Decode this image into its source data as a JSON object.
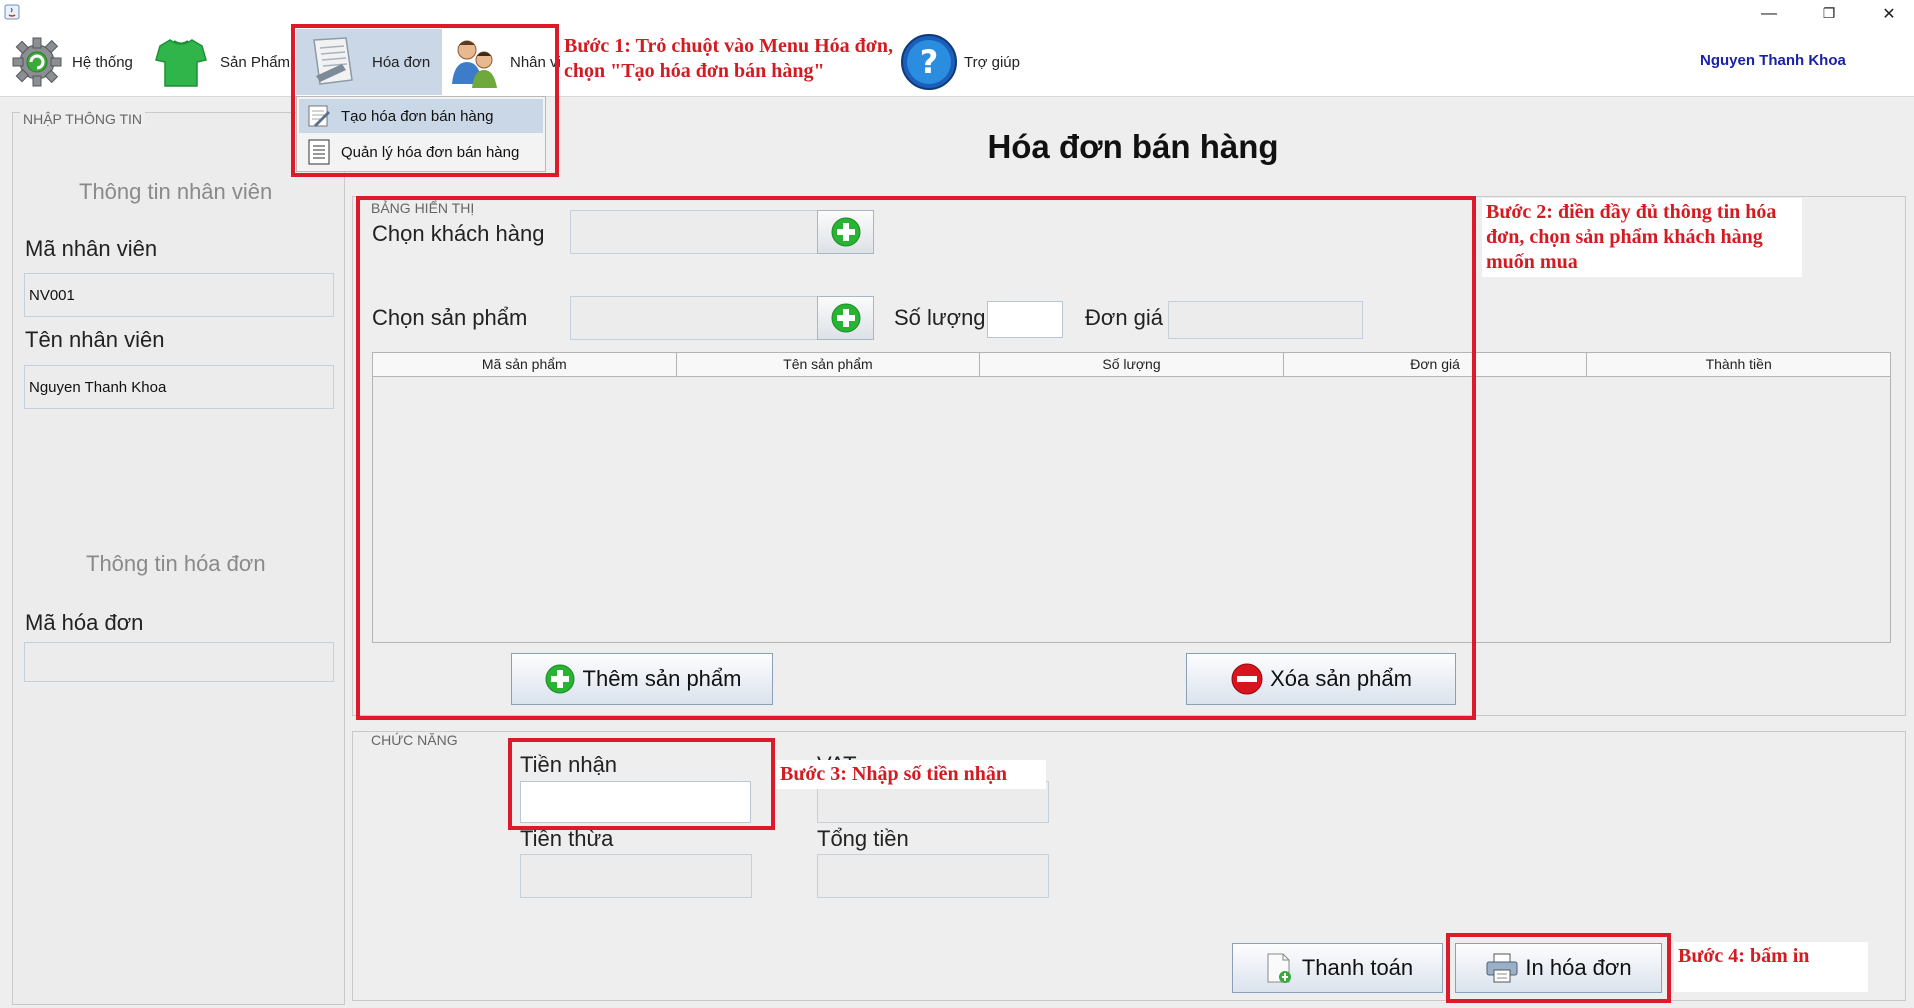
{
  "window": {
    "minimize": "—",
    "restore": "❐",
    "close": "✕"
  },
  "menu": {
    "items": [
      {
        "label": "Hệ thống",
        "icon": "gear-icon"
      },
      {
        "label": "Sản Phẩm",
        "icon": "shirt-icon"
      },
      {
        "label": "Hóa đơn",
        "icon": "receipt-icon"
      },
      {
        "label": "Nhân viên",
        "icon": "people-icon"
      },
      {
        "label": "Trợ giúp",
        "icon": "help-icon"
      }
    ],
    "user": "Nguyen Thanh Khoa",
    "dropdown": [
      "Tạo hóa đơn bán hàng",
      "Quản lý hóa đơn bán hàng"
    ]
  },
  "left": {
    "group_title": "NHẬP THÔNG TIN",
    "employee_section": "Thông tin nhân viên",
    "employee_id_label": "Mã nhân viên",
    "employee_id": "NV001",
    "employee_name_label": "Tên nhân viên",
    "employee_name": "Nguyen Thanh Khoa",
    "invoice_section": "Thông tin hóa đơn",
    "invoice_id_label": "Mã hóa đơn",
    "invoice_id": ""
  },
  "main": {
    "title": "Hóa đơn bán hàng",
    "display_group": "BẢNG HIỂN THỊ",
    "customer_label": "Chọn khách hàng",
    "product_label": "Chọn sản phẩm",
    "quantity_label": "Số lượng",
    "unit_price_label": "Đơn giá",
    "table_headers": [
      "Mã sản phẩm",
      "Tên sản phẩm",
      "Số lượng",
      "Đơn giá",
      "Thành tiền"
    ],
    "add_button": "Thêm sản phẩm",
    "delete_button": "Xóa sản phẩm",
    "function_group": "CHỨC NĂNG",
    "received_label": "Tiền nhận",
    "vat_label": "VAT",
    "change_label": "Tiền thừa",
    "total_label": "Tổng tiền",
    "pay_button": "Thanh toán",
    "print_button": "In hóa đơn"
  },
  "annotations": {
    "step1": "Bước 1: Trỏ chuột vào Menu Hóa đơn, chọn \"Tạo hóa đơn bán hàng\"",
    "step2": "Bước 2: điền đầy đủ thông tin hóa đơn, chọn sản phẩm khách hàng muốn mua",
    "step3": "Bước 3: Nhập số tiền nhận",
    "step4": "Bước 4: bấm in"
  },
  "colors": {
    "annotation_red": "#dd1a2a",
    "user_blue": "#1a22a8",
    "plus_green": "#28b433",
    "minus_red": "#d8141c"
  }
}
